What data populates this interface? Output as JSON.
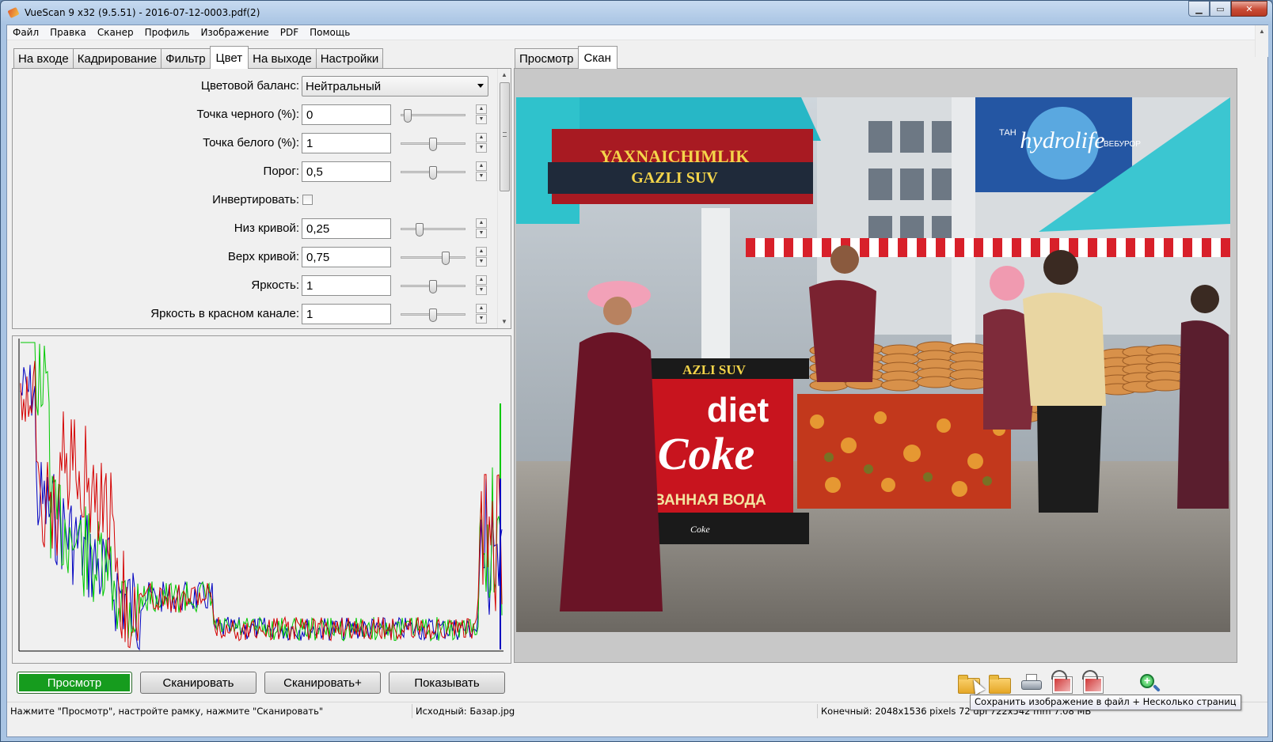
{
  "window": {
    "title": "VueScan 9 x32 (9.5.51) - 2016-07-12-0003.pdf(2)",
    "controls": {
      "minimize": "▁",
      "maximize": "▭",
      "close": "✕"
    }
  },
  "menu": [
    "Файл",
    "Правка",
    "Сканер",
    "Профиль",
    "Изображение",
    "PDF",
    "Помощь"
  ],
  "left_tabs": [
    "На входе",
    "Кадрирование",
    "Фильтр",
    "Цвет",
    "На выходе",
    "Настройки"
  ],
  "active_left_tab": "Цвет",
  "right_tabs": [
    "Просмотр",
    "Скан"
  ],
  "active_right_tab": "Скан",
  "settings": {
    "color_balance": {
      "label": "Цветовой баланс:",
      "value": "Нейтральный"
    },
    "black_point": {
      "label": "Точка черного (%):",
      "value": "0",
      "slider": 0.05
    },
    "white_point": {
      "label": "Точка белого (%):",
      "value": "1",
      "slider": 0.5
    },
    "threshold": {
      "label": "Порог:",
      "value": "0,5",
      "slider": 0.5
    },
    "invert": {
      "label": "Инвертировать:",
      "checked": false
    },
    "curve_low": {
      "label": "Низ кривой:",
      "value": "0,25",
      "slider": 0.27
    },
    "curve_high": {
      "label": "Верх кривой:",
      "value": "0,75",
      "slider": 0.72
    },
    "brightness": {
      "label": "Яркость:",
      "value": "1",
      "slider": 0.5
    },
    "red_brightness": {
      "label": "Яркость в красном канале:",
      "value": "1",
      "slider": 0.5
    }
  },
  "buttons": {
    "preview": "Просмотр",
    "scan": "Сканировать",
    "scan_plus": "Сканировать+",
    "show": "Показывать"
  },
  "image_text": {
    "sign_top": "YAXNAICHIMLIK",
    "sign_gazli": "GAZLI SUV",
    "counter_gazli": "AZLI SUV",
    "diet": "diet",
    "coke": "Coke",
    "voda": "ВАННАЯ ВОДА",
    "hydrolife": "hydrolife",
    "vatan": "ТАН",
    "veburor": "ВЕБУРОР",
    "coke_small": "Coke"
  },
  "tooltip": "Сохранить изображение в файл + Несколько страниц",
  "status": {
    "hint": "Нажмите \"Просмотр\", настройте рамку, нажмите \"Сканировать\"",
    "source": "Исходный: Базар.jpg",
    "output": "Конечный: 2048x1536 pixels 72 dpi 722x542 mm 7.08 MB"
  },
  "colors": {
    "primary_button": "#169c1e",
    "hist_red": "#d40000",
    "hist_green": "#00c800",
    "hist_blue": "#0000c0",
    "window_frame": "#a9c4e3"
  },
  "icons": [
    "save-folder-icon",
    "open-folder-icon",
    "printer-icon",
    "rotate-left-icon",
    "rotate-right-icon",
    "zoom-in-icon"
  ]
}
